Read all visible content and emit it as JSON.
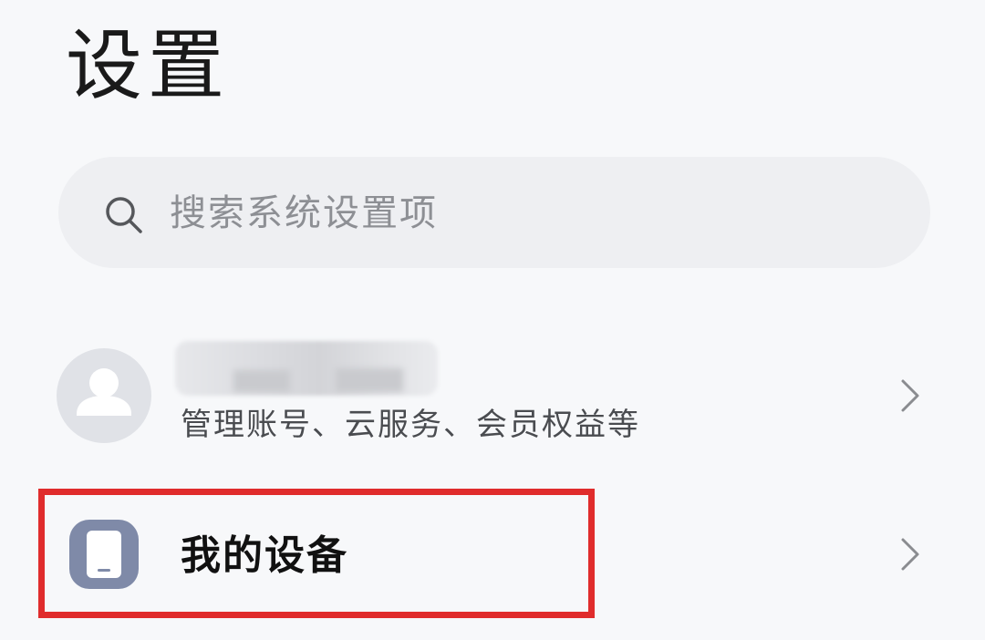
{
  "header": {
    "title": "设置"
  },
  "search": {
    "placeholder": "搜索系统设置项",
    "icon": "search-icon"
  },
  "account": {
    "name": "",
    "subtitle": "管理账号、云服务、会员权益等",
    "avatar_icon": "person-icon"
  },
  "settings_items": [
    {
      "label": "我的设备",
      "icon": "phone-icon"
    }
  ],
  "colors": {
    "background": "#f7f8fa",
    "search_background": "#eeeff2",
    "highlight": "#e02c2c",
    "device_icon": "#7f8aa8",
    "avatar_background": "#e0e2e7"
  }
}
